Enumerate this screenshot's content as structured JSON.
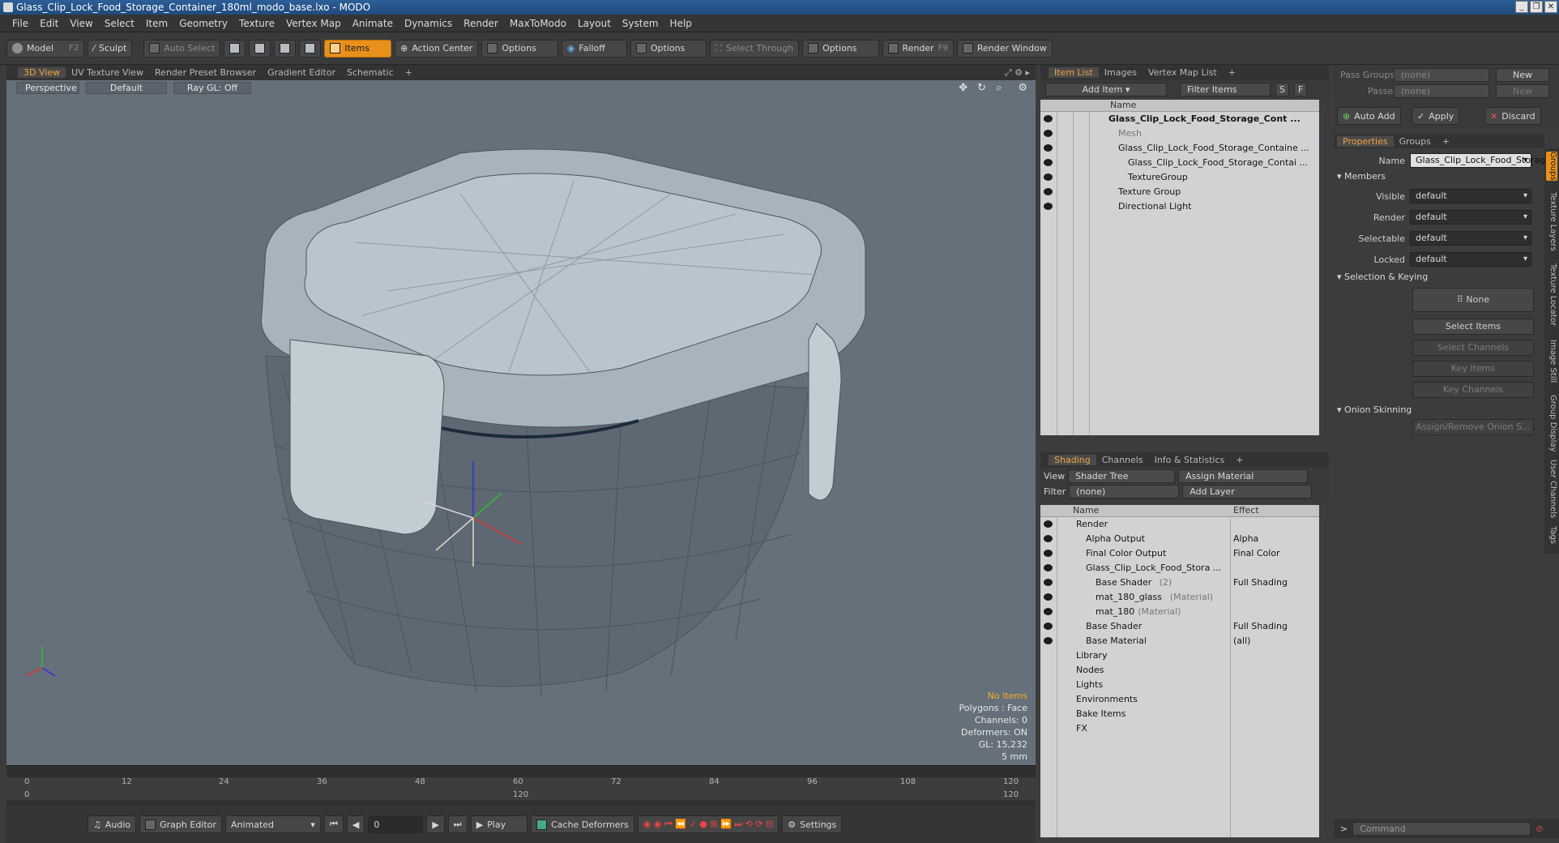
{
  "window": {
    "title": "Glass_Clip_Lock_Food_Storage_Container_180ml_modo_base.lxo - MODO"
  },
  "menu": [
    "File",
    "Edit",
    "View",
    "Select",
    "Item",
    "Geometry",
    "Texture",
    "Vertex Map",
    "Animate",
    "Dynamics",
    "Render",
    "MaxToModo",
    "Layout",
    "System",
    "Help"
  ],
  "toolbar": {
    "model": "Model",
    "model_key": "F2",
    "sculpt": "Sculpt",
    "auto_select": "Auto Select",
    "items": "Items",
    "action_center": "Action Center",
    "options1": "Options",
    "falloff": "Falloff",
    "options2": "Options",
    "select_through": "Select Through",
    "options3": "Options",
    "render": "Render",
    "render_key": "F9",
    "render_window": "Render Window"
  },
  "viewport": {
    "tabs": [
      "3D View",
      "UV Texture View",
      "Render Preset Browser",
      "Gradient Editor",
      "Schematic",
      "+"
    ],
    "perspective": "Perspective",
    "default": "Default",
    "raygl": "Ray GL: Off",
    "hud": {
      "no_items": "No Items",
      "polygons": "Polygons : Face",
      "channels": "Channels: 0",
      "deformers": "Deformers: ON",
      "gl": "GL: 15,232",
      "unit": "5 mm"
    }
  },
  "timeline": {
    "ticks": [
      "0",
      "12",
      "24",
      "36",
      "48",
      "60",
      "72",
      "84",
      "96",
      "108",
      "120"
    ],
    "start": "0",
    "mid": "120",
    "end": "120"
  },
  "transport": {
    "audio": "Audio",
    "graph_editor": "Graph Editor",
    "animated": "Animated",
    "frame": "0",
    "play": "Play",
    "cache": "Cache Deformers",
    "settings": "Settings"
  },
  "itemlist": {
    "tabs": [
      "Item List",
      "Images",
      "Vertex Map List",
      "+"
    ],
    "add_item": "Add Item",
    "filter": "Filter Items",
    "s": "S",
    "f": "F",
    "col_name": "Name",
    "rows": [
      {
        "label": "Glass_Clip_Lock_Food_Storage_Cont ...",
        "indent": 0,
        "bold": true
      },
      {
        "label": "Mesh",
        "indent": 1,
        "gray": true
      },
      {
        "label": "Glass_Clip_Lock_Food_Storage_Containe ...",
        "indent": 1
      },
      {
        "label": "Glass_Clip_Lock_Food_Storage_Contai ...",
        "indent": 2
      },
      {
        "label": "TextureGroup",
        "indent": 2
      },
      {
        "label": "Texture Group",
        "indent": 1
      },
      {
        "label": "Directional Light",
        "indent": 1
      }
    ]
  },
  "shading": {
    "tabs": [
      "Shading",
      "Channels",
      "Info & Statistics",
      "+"
    ],
    "view_label": "View",
    "view_value": "Shader Tree",
    "assign": "Assign Material",
    "filter_label": "Filter",
    "filter_value": "(none)",
    "add_layer": "Add Layer",
    "col_name": "Name",
    "col_effect": "Effect",
    "rows": [
      {
        "label": "Render",
        "effect": "",
        "indent": 0
      },
      {
        "label": "Alpha Output",
        "effect": "Alpha",
        "indent": 1
      },
      {
        "label": "Final Color Output",
        "effect": "Final Color",
        "indent": 1
      },
      {
        "label": "Glass_Clip_Lock_Food_Stora ...",
        "effect": "",
        "indent": 1
      },
      {
        "label": "Base Shader",
        "note": "(2)",
        "effect": "Full Shading",
        "indent": 2
      },
      {
        "label": "mat_180_glass",
        "note": "(Material)",
        "effect": "",
        "indent": 2
      },
      {
        "label": "mat_180",
        "note": "(Material)",
        "effect": "",
        "indent": 2
      },
      {
        "label": "Base Shader",
        "effect": "Full Shading",
        "indent": 1
      },
      {
        "label": "Base Material",
        "effect": "(all)",
        "indent": 1
      },
      {
        "label": "Library",
        "effect": "",
        "indent": 0
      },
      {
        "label": "Nodes",
        "effect": "",
        "indent": 0
      },
      {
        "label": "Lights",
        "effect": "",
        "indent": 0
      },
      {
        "label": "Environments",
        "effect": "",
        "indent": 0
      },
      {
        "label": "Bake Items",
        "effect": "",
        "indent": 0
      },
      {
        "label": "FX",
        "effect": "",
        "indent": 0
      }
    ]
  },
  "props": {
    "pass_groups": "Pass Groups",
    "passes": "Passes",
    "none": "(none)",
    "new": "New",
    "auto_add": "Auto Add",
    "apply": "Apply",
    "discard": "Discard",
    "tabs": [
      "Properties",
      "Groups",
      "+"
    ],
    "name_label": "Name",
    "name_value": "Glass_Clip_Lock_Food_Storag",
    "members": "Members",
    "visible": "Visible",
    "render": "Render",
    "selectable": "Selectable",
    "locked": "Locked",
    "default": "default",
    "sel_keying": "Selection & Keying",
    "none_btn": "None",
    "select_items": "Select Items",
    "select_channels": "Select Channels",
    "key_items": "Key Items",
    "key_channels": "Key Channels",
    "onion": "Onion Skinning",
    "assign_onion": "Assign/Remove Onion S...",
    "vtabs": [
      "Groups",
      "Texture Layers",
      "Texture Locator",
      "Image Still",
      "Group Display",
      "User Channels",
      "Tags"
    ],
    "command": "Command"
  },
  "colors": {
    "accent": "#e8901c",
    "viewport": "#65707b"
  }
}
